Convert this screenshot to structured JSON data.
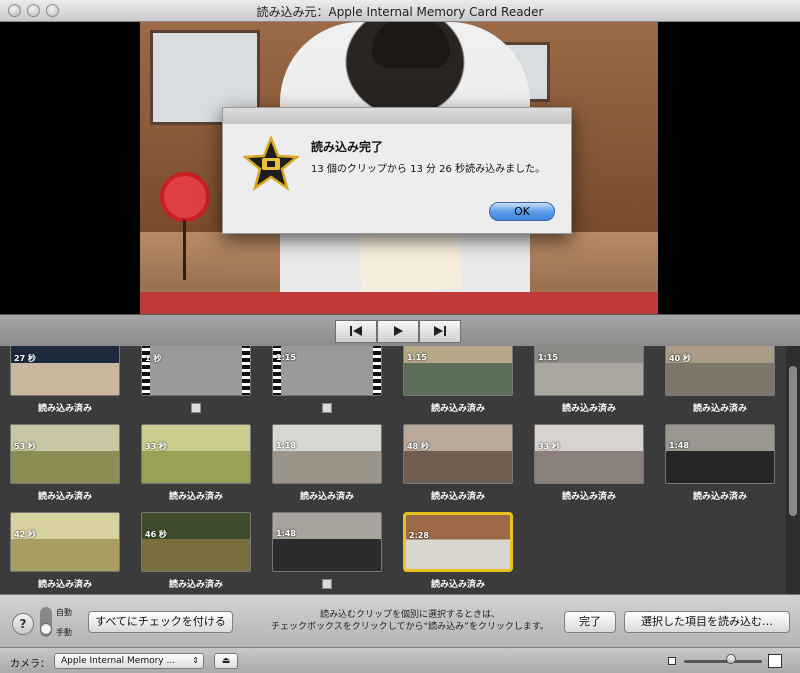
{
  "window": {
    "title": "読み込み元：Apple Internal Memory Card Reader"
  },
  "dialog": {
    "title": "読み込み完了",
    "message": "13 個のクリップから 13 分 26 秒読み込みました。",
    "ok_label": "OK",
    "icon": "imovie-star-icon"
  },
  "transport": {
    "prev": "◀︎|",
    "play": "▶",
    "next": "|▶︎"
  },
  "clips": [
    {
      "duration": "27 秒",
      "label": "読み込み済み",
      "colors": [
        "#1e2b3d",
        "#c9b7a0"
      ]
    },
    {
      "duration": "1 秒",
      "label": "",
      "placeholder": true
    },
    {
      "duration": "1:15",
      "label": "",
      "placeholder": true
    },
    {
      "duration": "1:15",
      "label": "読み込み済み",
      "colors": [
        "#b7a889",
        "#5d6e5a"
      ]
    },
    {
      "duration": "1:15",
      "label": "読み込み済み",
      "colors": [
        "#8c8a84",
        "#a9a7a0"
      ]
    },
    {
      "duration": "40 秒",
      "label": "読み込み済み",
      "colors": [
        "#a99b86",
        "#7f766a"
      ]
    },
    {
      "duration": "53 秒",
      "label": "読み込み済み",
      "colors": [
        "#c9c6a2",
        "#8b8d55"
      ]
    },
    {
      "duration": "33 秒",
      "label": "読み込み済み",
      "colors": [
        "#cbcc8e",
        "#9aa055"
      ]
    },
    {
      "duration": "1:18",
      "label": "読み込み済み",
      "colors": [
        "#d7d8d2",
        "#9b9488"
      ]
    },
    {
      "duration": "48 秒",
      "label": "読み込み済み",
      "colors": [
        "#b9a99b",
        "#6f5e50"
      ]
    },
    {
      "duration": "33 秒",
      "label": "読み込み済み",
      "colors": [
        "#d8d3cf",
        "#8a7f7a"
      ]
    },
    {
      "duration": "1:48",
      "label": "読み込み済み",
      "colors": [
        "#9a9690",
        "#262626"
      ]
    },
    {
      "duration": "42 秒",
      "label": "読み込み済み",
      "colors": [
        "#d7d1a0",
        "#a99e62"
      ]
    },
    {
      "duration": "46 秒",
      "label": "読み込み済み",
      "colors": [
        "#3f4c2c",
        "#7a6e40"
      ]
    },
    {
      "duration": "1:48",
      "label": "",
      "colors": [
        "#a8a39c",
        "#2c2c2c"
      ],
      "checkbox": true
    },
    {
      "duration": "2:28",
      "label": "読み込み済み",
      "colors": [
        "#9d6a48",
        "#d9d6d0"
      ],
      "selected": true
    }
  ],
  "toolbar": {
    "mode_auto": "自動",
    "mode_manual": "手動",
    "check_all": "すべてにチェックを付ける",
    "hint_line1": "読み込むクリップを個別に選択するときは、",
    "hint_line2": "チェックボックスをクリックしてから“読み込み”をクリックします。",
    "done": "完了",
    "import_selected": "選択した項目を読み込む…",
    "help": "?"
  },
  "status": {
    "camera_label": "カメラ：",
    "camera_value": "Apple Internal Memory ...",
    "eject": "⏏",
    "zoom": 0.6
  }
}
